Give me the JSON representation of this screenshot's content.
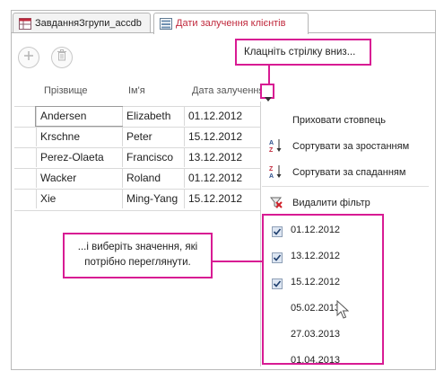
{
  "tabs": [
    {
      "label": "ЗавданняЗгрупи_accdb",
      "icon": "table-icon"
    },
    {
      "label": "Дати залучення клієнтів",
      "icon": "form-icon"
    }
  ],
  "toolbar": {
    "add_icon": "plus-icon",
    "delete_icon": "trash-icon"
  },
  "callout_top": "Клацніть стрілку вниз...",
  "callout_left": "...і виберіть значення, які потрібно переглянути.",
  "columns": [
    "Прізвище",
    "Ім'я",
    "Дата залучення"
  ],
  "rows": [
    [
      "Andersen",
      "Elizabeth",
      "01.12.2012"
    ],
    [
      "Krschne",
      "Peter",
      "15.12.2012"
    ],
    [
      "Perez-Olaeta",
      "Francisco",
      "13.12.2012"
    ],
    [
      "Wacker",
      "Roland",
      "01.12.2012"
    ],
    [
      "Xie",
      "Ming-Yang",
      "15.12.2012"
    ]
  ],
  "menu": {
    "hide_column": "Приховати стовпець",
    "sort_asc": "Сортувати за зростанням",
    "sort_desc": "Сортувати за спаданням",
    "clear_filter": "Видалити фільтр"
  },
  "filter_values": [
    {
      "label": "01.12.2012",
      "checked": true
    },
    {
      "label": "13.12.2012",
      "checked": true
    },
    {
      "label": "15.12.2012",
      "checked": true
    },
    {
      "label": "05.02.2013",
      "checked": false
    },
    {
      "label": "27.03.2013",
      "checked": false
    },
    {
      "label": "01.04.2013",
      "checked": false
    }
  ],
  "colors": {
    "accent": "#d81b93",
    "tab_active_text": "#c0283c"
  }
}
